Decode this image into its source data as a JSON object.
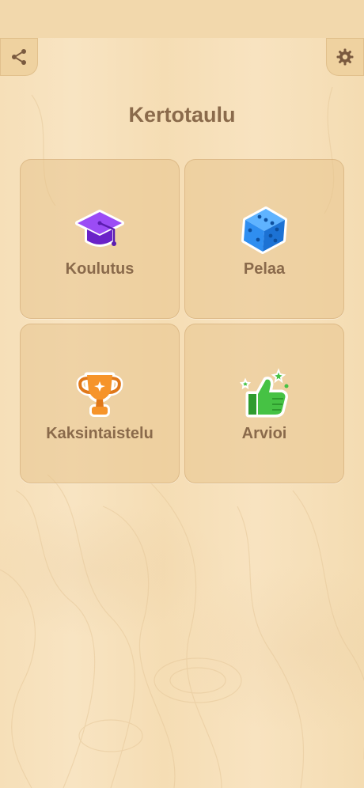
{
  "app": {
    "title": "Kertotaulu"
  },
  "toolbar": {
    "share_icon": "share-icon",
    "settings_icon": "gear-icon"
  },
  "menu": {
    "items": [
      {
        "label": "Koulutus",
        "icon": "graduation-cap-icon",
        "color": "#8a3df0"
      },
      {
        "label": "Pelaa",
        "icon": "dice-icon",
        "color": "#2f8ef0"
      },
      {
        "label": "Kaksintaistelu",
        "icon": "trophy-icon",
        "color": "#f28a1e"
      },
      {
        "label": "Arvioi",
        "icon": "thumbs-up-icon",
        "color": "#3bb83a"
      }
    ]
  },
  "colors": {
    "background": "#f7e2bd",
    "text": "#8a6a4b",
    "tile": "#e8c48e"
  }
}
